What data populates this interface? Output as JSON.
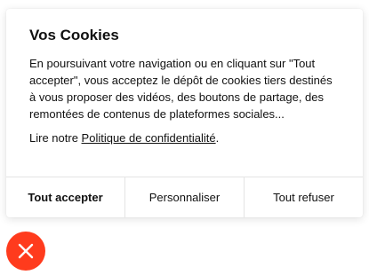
{
  "cookie_banner": {
    "title": "Vos Cookies",
    "body": "En poursuivant votre navigation ou en cliquant sur \"Tout accepter\", vous acceptez le dépôt de cookies tiers destinés à vous proposer des vidéos, des boutons de partage, des remontées de contenus de plateformes sociales...",
    "policy_prefix": "Lire notre ",
    "policy_link": "Politique de confidentialité",
    "policy_suffix": ".",
    "buttons": {
      "accept_all": "Tout accepter",
      "customize": "Personnaliser",
      "refuse_all": "Tout refuser"
    }
  },
  "close_button": {
    "icon": "close-icon",
    "color": "#ff3b1d"
  }
}
